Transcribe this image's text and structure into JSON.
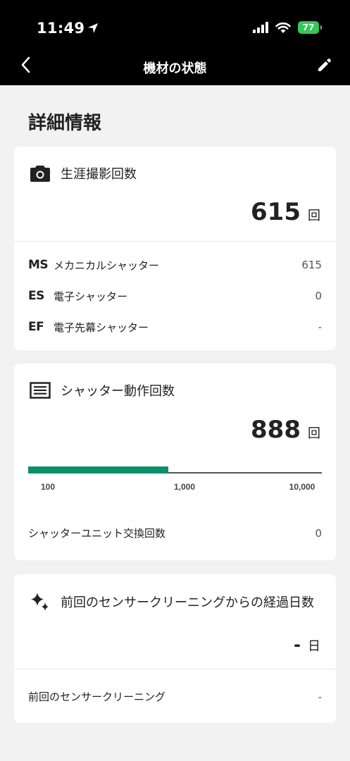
{
  "status_bar": {
    "time": "11:49",
    "battery": "77"
  },
  "nav": {
    "title": "機材の状態"
  },
  "section_title": "詳細情報",
  "card_shots": {
    "title": "生涯撮影回数",
    "count": "615",
    "unit": "回",
    "rows": [
      {
        "abbr": "MS",
        "label": "メカニカルシャッター",
        "value": "615"
      },
      {
        "abbr": "ES",
        "label": "電子シャッター",
        "value": "0"
      },
      {
        "abbr": "EF",
        "label": "電子先幕シャッター",
        "value": "-"
      }
    ]
  },
  "card_shutter": {
    "title": "シャッター動作回数",
    "count": "888",
    "unit": "回",
    "progress": {
      "value": 888,
      "scale": "log",
      "ticks": [
        "100",
        "1,000",
        "10,000"
      ]
    },
    "unit_replacement_label": "シャッターユニット交換回数",
    "unit_replacement_value": "0"
  },
  "card_sensor": {
    "title": "前回のセンサークリーニングからの経過日数",
    "days": "-",
    "unit": "日",
    "last_cleaning_label": "前回のセンサークリーニング",
    "last_cleaning_value": "-"
  },
  "colors": {
    "accent": "#0a8f6a",
    "header_bg": "#000000",
    "page_bg": "#f2f2f2"
  }
}
